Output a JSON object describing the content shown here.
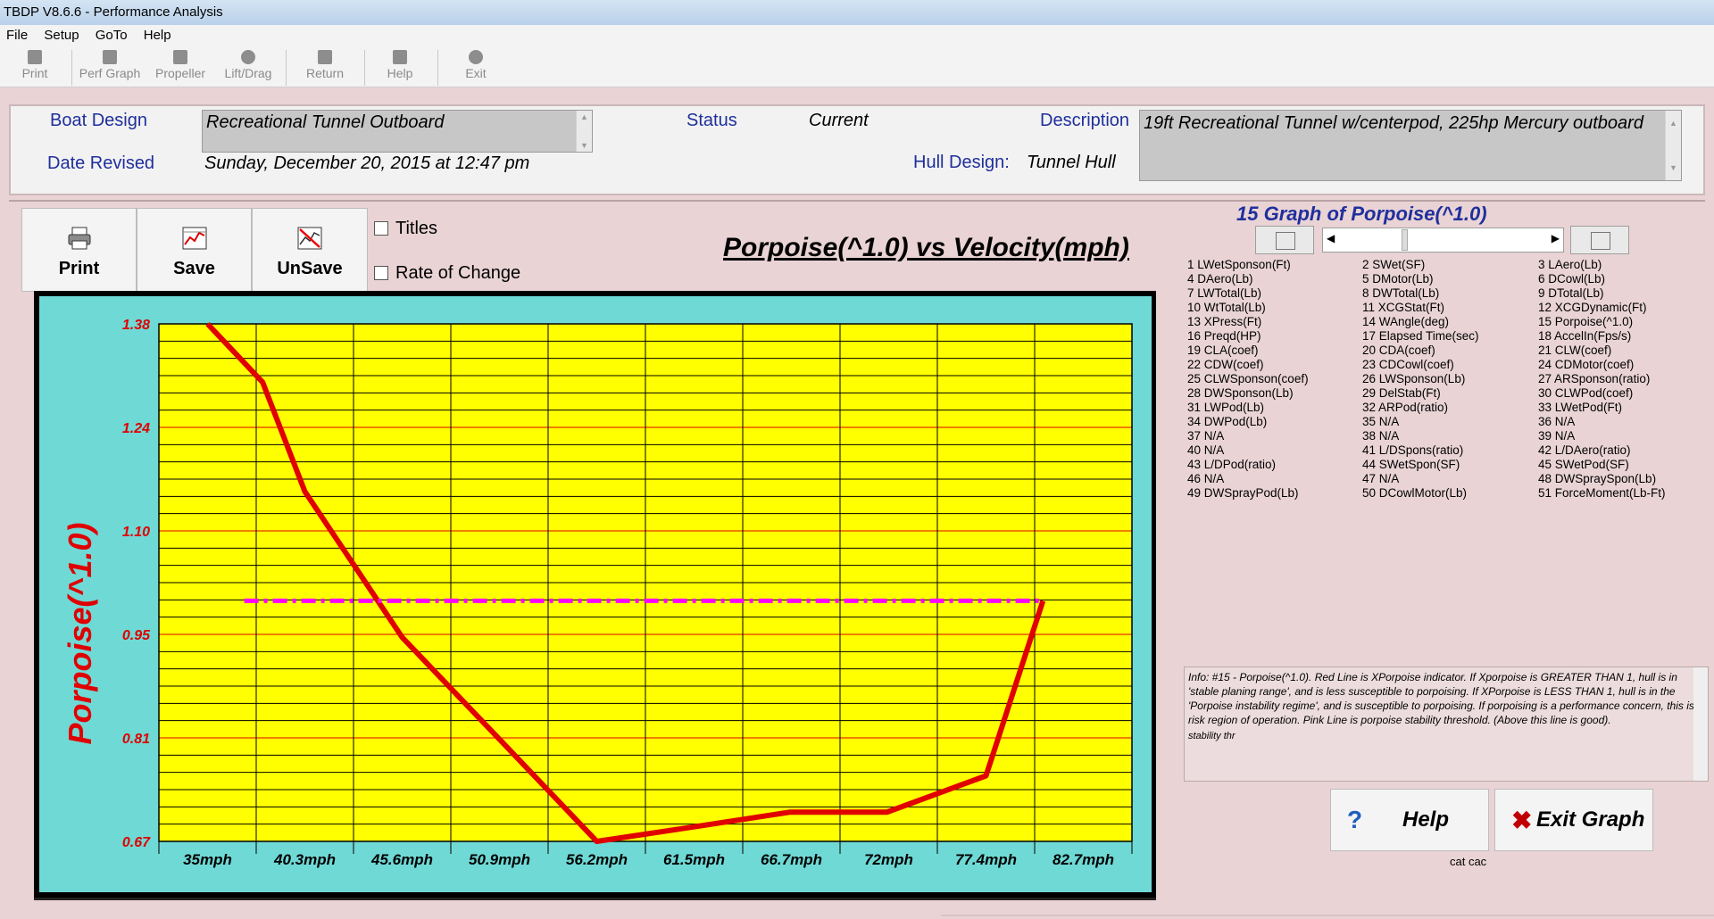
{
  "window": {
    "title": "TBDP V8.6.6 - Performance Analysis"
  },
  "menu": [
    "File",
    "Setup",
    "GoTo",
    "Help"
  ],
  "toolbar": [
    {
      "label": "Print",
      "icon": "printer-icon"
    },
    {
      "label": "Perf Graph",
      "icon": "graph-icon"
    },
    {
      "label": "Propeller",
      "icon": "propeller-icon"
    },
    {
      "label": "Lift/Drag",
      "icon": "lift-drag-icon"
    },
    {
      "label": "Return",
      "icon": "return-icon"
    },
    {
      "label": "Help",
      "icon": "help-icon"
    },
    {
      "label": "Exit",
      "icon": "exit-icon"
    }
  ],
  "header": {
    "boat_design_label": "Boat Design",
    "boat_design_value": "Recreational Tunnel Outboard",
    "date_revised_label": "Date Revised",
    "date_revised_value": "Sunday, December 20, 2015 at 12:47 pm",
    "status_label": "Status",
    "status_value": "Current",
    "hull_design_label": "Hull Design:",
    "hull_design_value": "Tunnel Hull",
    "description_label": "Description",
    "description_value": "19ft Recreational Tunnel w/centerpod, 225hp Mercury outboard"
  },
  "buttons": {
    "print": "Print",
    "save": "Save",
    "unsave": "UnSave",
    "help": "Help",
    "exit_graph": "Exit Graph"
  },
  "checkboxes": {
    "titles": "Titles",
    "rate_of_change": "Rate of Change"
  },
  "graph_selector": {
    "heading": "15 Graph of Porpoise(^1.0)"
  },
  "graph_list": [
    "1 LWetSponson(Ft)",
    "2 SWet(SF)",
    "3 LAero(Lb)",
    "4 DAero(Lb)",
    "5 DMotor(Lb)",
    "6 DCowl(Lb)",
    "7 LWTotal(Lb)",
    "8 DWTotal(Lb)",
    "9 DTotal(Lb)",
    "10 WtTotal(Lb)",
    "11 XCGStat(Ft)",
    "12 XCGDynamic(Ft)",
    "13 XPress(Ft)",
    "14 WAngle(deg)",
    "15 Porpoise(^1.0)",
    "16 Preqd(HP)",
    "17 Elapsed Time(sec)",
    "18 AccelIn(Fps/s)",
    "19 CLA(coef)",
    "20 CDA(coef)",
    "21 CLW(coef)",
    "22 CDW(coef)",
    "23 CDCowl(coef)",
    "24 CDMotor(coef)",
    "25 CLWSponson(coef)",
    "26 LWSponson(Lb)",
    "27 ARSponson(ratio)",
    "28 DWSponson(Lb)",
    "29 DelStab(Ft)",
    "30 CLWPod(coef)",
    "31 LWPod(Lb)",
    "32 ARPod(ratio)",
    "33 LWetPod(Ft)",
    "34 DWPod(Lb)",
    "35 N/A",
    "36 N/A",
    "37 N/A",
    "38 N/A",
    "39 N/A",
    "40 N/A",
    "41 L/DSpons(ratio)",
    "42 L/DAero(ratio)",
    "43 L/DPod(ratio)",
    "44 SWetSpon(SF)",
    "45 SWetPod(SF)",
    "46 N/A",
    "47 N/A",
    "48 DWSpraySpon(Lb)",
    "49 DWSprayPod(Lb)",
    "50 DCowlMotor(Lb)",
    "51 ForceMoment(Lb-Ft)"
  ],
  "info": {
    "text": "Info: #15 - Porpoise(^1.0). Red Line is XPorpoise indicator.  If Xporpoise is GREATER THAN 1, hull is in 'stable planing range', and is less susceptible to porpoising. If XPorpoise is LESS THAN 1, hull is in the 'Porpoise instability regime', and is susceptible to porpoising. If porpoising is a performance concern, this is a risk region of operation.  Pink Line is porpoise stability threshold. (Above this line is good).",
    "trail": "stability thr"
  },
  "footer_note": "cat cac",
  "chart_data": {
    "type": "line",
    "title": "Porpoise(^1.0) vs Velocity(mph)",
    "ylabel": "Porpoise(^1.0)",
    "xlabel": "",
    "categories": [
      "35mph",
      "40.3mph",
      "45.6mph",
      "50.9mph",
      "56.2mph",
      "61.5mph",
      "66.7mph",
      "72mph",
      "77.4mph",
      "82.7mph"
    ],
    "y_ticks": [
      "1.38",
      "1.24",
      "1.10",
      "0.95",
      "0.81",
      "0.67"
    ],
    "ylim": [
      0.67,
      1.38
    ],
    "series": [
      {
        "color": "#e00000",
        "style": "solid",
        "points": [
          [
            35,
            1.38
          ],
          [
            38,
            1.3
          ],
          [
            40.3,
            1.15
          ],
          [
            45.6,
            0.95
          ],
          [
            50.9,
            0.81
          ],
          [
            56.2,
            0.67
          ],
          [
            61.5,
            0.69
          ],
          [
            66.7,
            0.71
          ],
          [
            72,
            0.71
          ],
          [
            77.4,
            0.76
          ],
          [
            80.5,
            1.0
          ]
        ]
      },
      {
        "color": "#ff00ff",
        "style": "dash-dot",
        "points": [
          [
            37,
            1.0
          ],
          [
            80.5,
            1.0
          ]
        ]
      }
    ],
    "grid": true,
    "colors": {
      "plot_bg": "#ffff00",
      "frame_bg": "#6fd9d5",
      "grid_major": "#000000",
      "grid_minor": "#e00000",
      "tick_text": "#e00000"
    }
  }
}
